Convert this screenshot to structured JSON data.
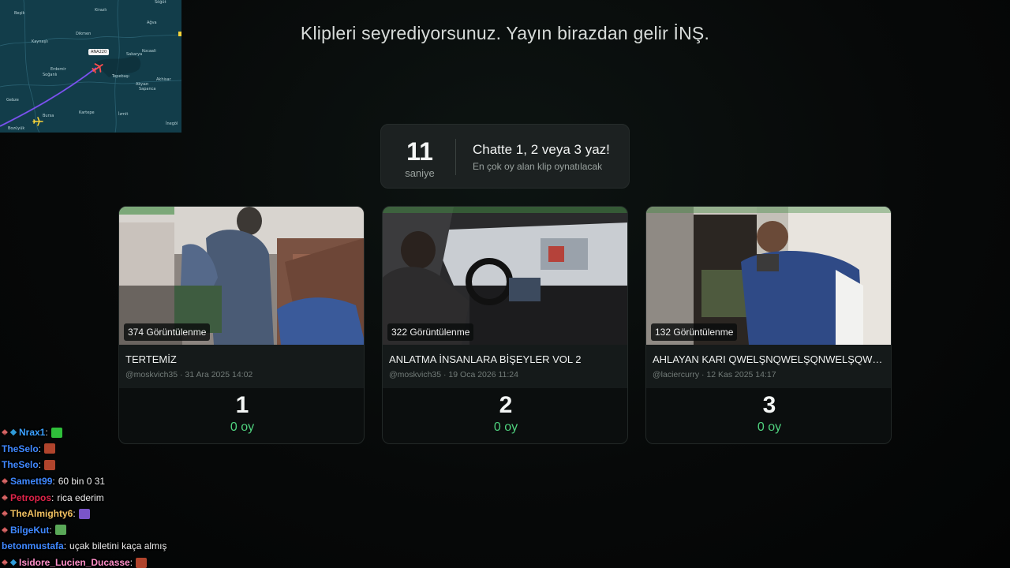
{
  "headline": "Klipleri seyrediyorsunuz. Yayın birazdan gelir İNŞ.",
  "map": {
    "flight_tag": "ANA220",
    "cities": [
      "Beşik",
      "Dikmen",
      "Kirazlı",
      "Ağva",
      "Kocaali",
      "Kaynaşlı",
      "Erdemir",
      "Soğanlı",
      "Akhisar",
      "Tepebaşı",
      "Sakarya",
      "Sapanca",
      "Akyazı",
      "Kartepe",
      "İzmit",
      "Gebze",
      "Bursa",
      "İnegöl",
      "Bozüyük",
      "Söğüt"
    ]
  },
  "timer": {
    "seconds": "11",
    "unit": "saniye",
    "title": "Chatte 1, 2 veya 3 yaz!",
    "subtitle": "En çok oy alan klip oynatılacak"
  },
  "clips": [
    {
      "views": "374 Görüntülenme",
      "title": "TERTEMİZ",
      "info": "@moskvich35 · 31 Ara 2025 14:02",
      "number": "1",
      "votes": "0 oy"
    },
    {
      "views": "322 Görüntülenme",
      "title": "ANLATMA İNSANLARA BİŞEYLER VOL 2",
      "info": "@moskvich35 · 19 Oca 2026 11:24",
      "number": "2",
      "votes": "0 oy"
    },
    {
      "views": "132 Görüntülenme",
      "title": "AHLAYAN KARI QWELŞNQWELŞQNWELŞQWNLEŞQWNEL",
      "info": "@laciercurry · 12 Kas 2025 14:17",
      "number": "3",
      "votes": "0 oy"
    }
  ],
  "chat": [
    {
      "user": "Nrax1",
      "color": "#3aa0ff",
      "text": "",
      "emote": "#2fbf3a",
      "badges": [
        "pencil",
        "diamond"
      ]
    },
    {
      "user": "TheSelo",
      "color": "#3f88ff",
      "text": "",
      "emote": "#b0442c",
      "badges": []
    },
    {
      "user": "TheSelo",
      "color": "#3f88ff",
      "text": "",
      "emote": "#b0442c",
      "badges": []
    },
    {
      "user": "Samett99",
      "color": "#3f88ff",
      "text": "60 bin 0 31",
      "emote": "",
      "badges": [
        "pencil"
      ]
    },
    {
      "user": "Petropos",
      "color": "#e0244a",
      "text": "rica ederim",
      "emote": "",
      "badges": [
        "pencil"
      ]
    },
    {
      "user": "TheAlmighty6",
      "color": "#f0c060",
      "text": "",
      "emote": "#7a55c8",
      "badges": [
        "pencil"
      ]
    },
    {
      "user": "BilgeKut",
      "color": "#3f88ff",
      "text": "",
      "emote": "#5aa858",
      "badges": [
        "pencil"
      ]
    },
    {
      "user": "betonmustafa",
      "color": "#3f88ff",
      "text": "uçak biletini kaça almış",
      "emote": "",
      "badges": []
    },
    {
      "user": "Isidore_Lucien_Ducasse",
      "color": "#ff8fc8",
      "text": "",
      "emote": "#b0442c",
      "badges": [
        "pencil",
        "diamond"
      ]
    }
  ]
}
